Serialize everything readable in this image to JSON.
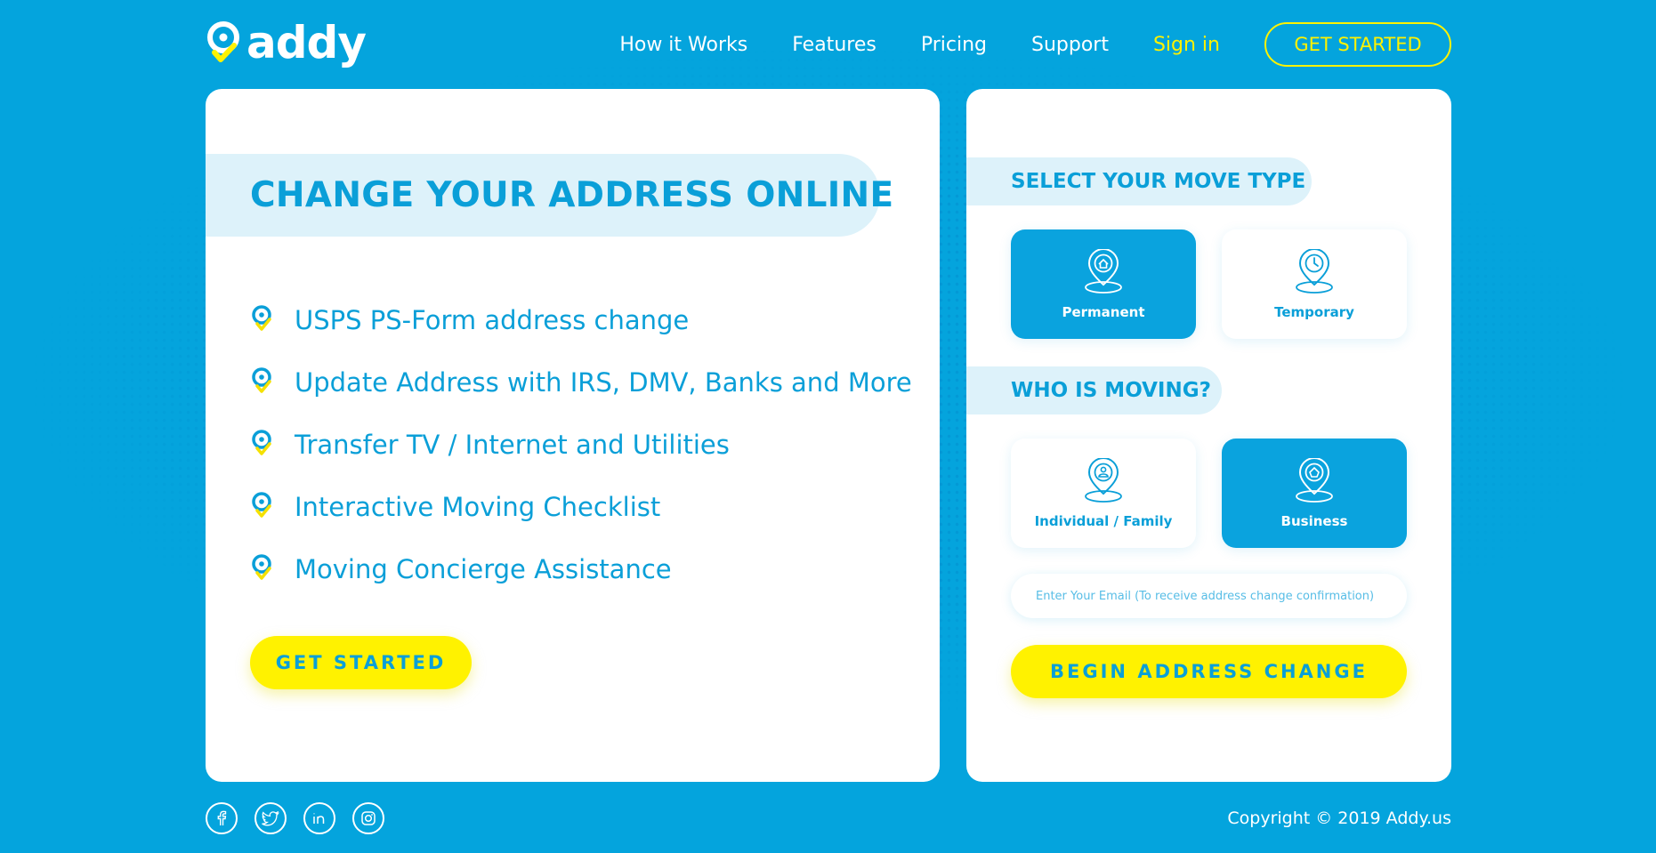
{
  "header": {
    "logo_text": "addy",
    "nav": [
      {
        "label": "How it Works"
      },
      {
        "label": "Features"
      },
      {
        "label": "Pricing"
      },
      {
        "label": "Support"
      },
      {
        "label": "Sign in"
      }
    ],
    "cta_label": "GET STARTED"
  },
  "hero": {
    "title": "CHANGE YOUR ADDRESS ONLINE",
    "features": [
      "USPS PS-Form address change",
      "Update Address with IRS, DMV, Banks and More",
      "Transfer TV / Internet and Utilities",
      "Interactive Moving Checklist",
      "Moving Concierge Assistance"
    ],
    "cta_label": "GET STARTED"
  },
  "form": {
    "move_type_label": "SELECT YOUR MOVE TYPE",
    "move_types": [
      {
        "label": "Permanent",
        "icon": "home-pin-icon",
        "selected": true
      },
      {
        "label": "Temporary",
        "icon": "clock-pin-icon",
        "selected": false
      }
    ],
    "who_label": "WHO IS MOVING?",
    "who_options": [
      {
        "label": "Individual / Family",
        "icon": "person-pin-icon",
        "selected": false
      },
      {
        "label": "Business",
        "icon": "building-pin-icon",
        "selected": true
      }
    ],
    "email_placeholder": "Enter Your Email (To receive address change confirmation)",
    "email_value": "",
    "submit_label": "BEGIN ADDRESS CHANGE"
  },
  "footer": {
    "social": [
      "facebook-icon",
      "twitter-icon",
      "linkedin-icon",
      "instagram-icon"
    ],
    "copyright": "Copyright © 2019 Addy.us"
  },
  "colors": {
    "background": "#04a4dd",
    "accent_yellow": "#fff200",
    "primary_blue": "#0a9fd8",
    "label_bg": "#ddf2fa"
  }
}
